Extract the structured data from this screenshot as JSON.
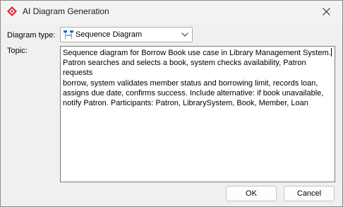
{
  "window": {
    "title": "AI Diagram Generation",
    "app_icon": "app-logo-icon",
    "close_icon": "close-icon"
  },
  "form": {
    "diagram_type_label": "Diagram type:",
    "diagram_type_value": "Sequence Diagram",
    "diagram_type_icon": "sequence-diagram-icon",
    "topic_label": "Topic:",
    "topic_text": "Sequence diagram for Borrow Book use case in Library Management System.\nPatron searches and selects a book, system checks availability, Patron requests\nborrow, system validates member status and borrowing limit, records loan,\nassigns due date, confirms success. Include alternative: if book unavailable,\nnotify Patron. Participants: Patron, LibrarySystem, Book, Member, Loan"
  },
  "buttons": {
    "ok_label": "OK",
    "cancel_label": "Cancel"
  },
  "colors": {
    "accent": "#d9232e",
    "diagram_icon": "#1f6fd1"
  }
}
